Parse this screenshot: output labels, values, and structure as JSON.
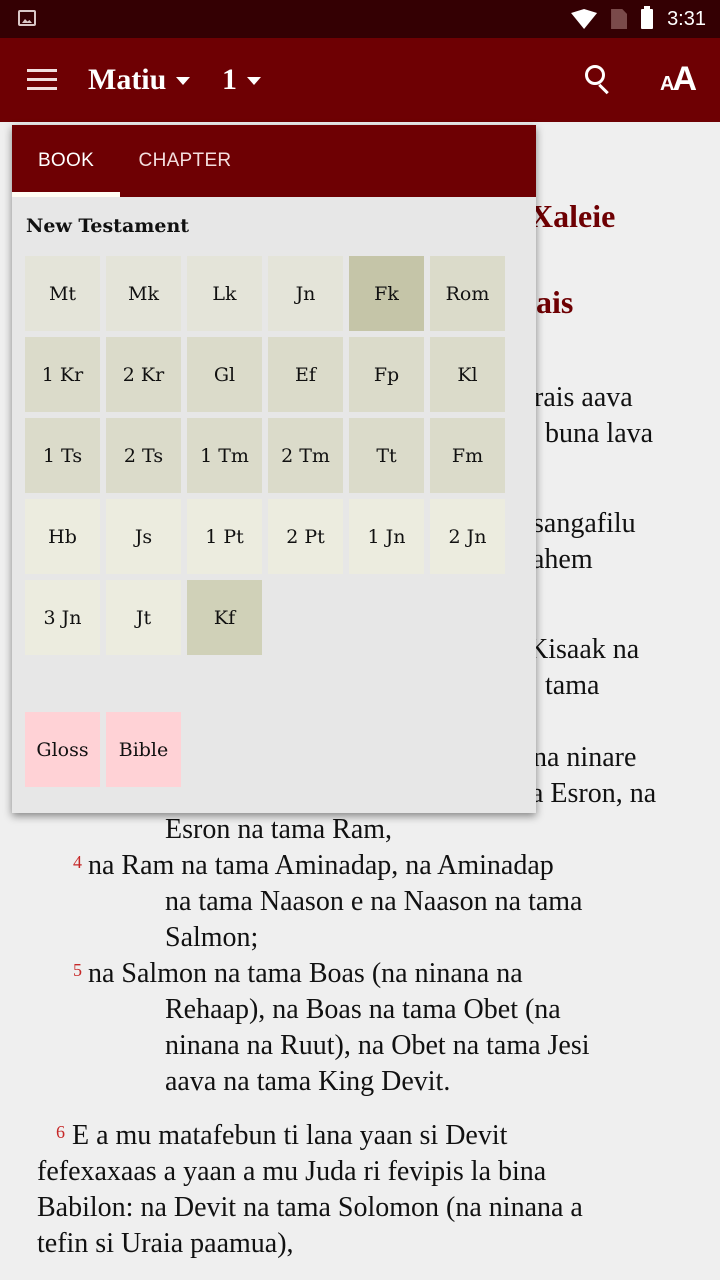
{
  "status_bar": {
    "time": "3:31",
    "icons": [
      "gallery-icon",
      "wifi-icon",
      "no-sim-icon",
      "battery-icon"
    ]
  },
  "app_bar": {
    "menu_icon": "hamburger-menu-icon",
    "book": "Matiu",
    "chapter": "1",
    "search_icon": "search-icon",
    "font_size_icon": "font-size-icon",
    "font_small": "A",
    "font_big": "A"
  },
  "colors": {
    "primary": "#6e0003",
    "status_bar": "#340003",
    "verse_number": "#c62828",
    "extra_tile": "#ffd2d6"
  },
  "popup": {
    "tabs": [
      {
        "label": "BOOK",
        "active": true
      },
      {
        "label": "CHAPTER",
        "active": false
      }
    ],
    "section_title": "New Testament",
    "books": [
      {
        "label": "Mt",
        "group": "gospel"
      },
      {
        "label": "Mk",
        "group": "gospel"
      },
      {
        "label": "Lk",
        "group": "gospel"
      },
      {
        "label": "Jn",
        "group": "gospel"
      },
      {
        "label": "Fk",
        "group": "history"
      },
      {
        "label": "Rom",
        "group": "letter"
      },
      {
        "label": "1 Kr",
        "group": "letter"
      },
      {
        "label": "2 Kr",
        "group": "letter"
      },
      {
        "label": "Gl",
        "group": "letter"
      },
      {
        "label": "Ef",
        "group": "letter"
      },
      {
        "label": "Fp",
        "group": "letter"
      },
      {
        "label": "Kl",
        "group": "letter"
      },
      {
        "label": "1 Ts",
        "group": "letter"
      },
      {
        "label": "2 Ts",
        "group": "letter"
      },
      {
        "label": "1 Tm",
        "group": "letter"
      },
      {
        "label": "2 Tm",
        "group": "letter"
      },
      {
        "label": "Tt",
        "group": "letter"
      },
      {
        "label": "Fm",
        "group": "letter"
      },
      {
        "label": "Hb",
        "group": "general"
      },
      {
        "label": "Js",
        "group": "general"
      },
      {
        "label": "1 Pt",
        "group": "general"
      },
      {
        "label": "2 Pt",
        "group": "general"
      },
      {
        "label": "1 Jn",
        "group": "general"
      },
      {
        "label": "2 Jn",
        "group": "general"
      },
      {
        "label": "3 Jn",
        "group": "general"
      },
      {
        "label": "Jt",
        "group": "general"
      },
      {
        "label": "Kf",
        "group": "apoc"
      }
    ],
    "extras": [
      {
        "label": "Gloss"
      },
      {
        "label": "Bible"
      }
    ]
  },
  "reader": {
    "headings": [
      "Xaleie",
      "ais"
    ],
    "visible_right_lines": [
      "rais aava",
      "buna lava",
      "sangafilu",
      "ahem",
      "Kisaak na",
      "tama",
      "na ninare",
      "a Esron, na"
    ],
    "lines_after_popup": [
      "Esron na tama Ram,"
    ],
    "verses": [
      {
        "number": "4",
        "lines": [
          "na Ram na tama Aminadap, na Aminadap",
          "na tama Naason e na Naason na tama",
          "Salmon;"
        ]
      },
      {
        "number": "5",
        "lines": [
          "na Salmon na tama Boas (na ninana na",
          "Rehaap), na Boas na tama Obet (na",
          "ninana na Ruut), na Obet na tama Jesi",
          "aava na tama King Devit."
        ]
      },
      {
        "number": "6",
        "lines": [
          "E a mu matafebun ti lana yaan si Devit",
          "fefexaxaas a yaan a mu Juda ri fevipis la bina",
          "Babilon: na Devit na tama Solomon (na ninana a",
          "tefin si Uraia paamua),"
        ]
      }
    ]
  }
}
